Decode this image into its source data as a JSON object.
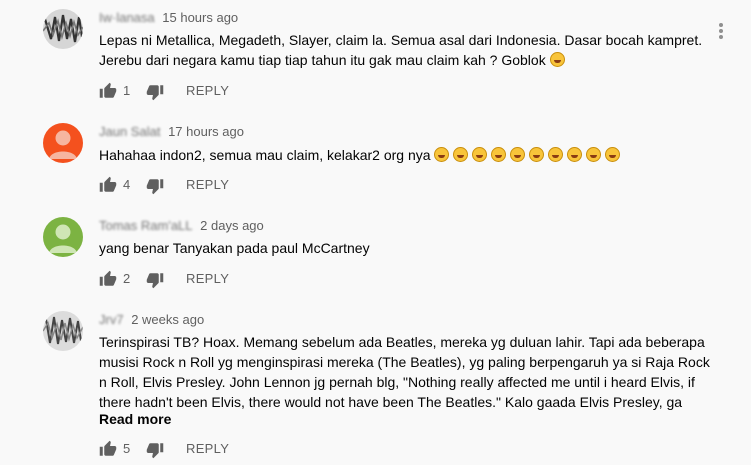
{
  "comments": [
    {
      "author_name": "Iw·lanasa",
      "time": "15 hours ago",
      "text_lines": [
        "Lepas ni Metallica, Megadeth, Slayer, claim la. Semua asal dari Indonesia. Dasar bocah kampret.",
        "Jerebu dari negara kamu tiap tiap tahun itu gak mau claim kah ? Goblok"
      ],
      "likes": "1",
      "reply_label": "REPLY",
      "avatar": "static-pattern-avatar"
    },
    {
      "author_name": "Jaun Salat",
      "time": "17 hours ago",
      "text_lines": [
        "Hahahaa indon2, semua mau claim, kelakar2 org nya"
      ],
      "emoji_count": 10,
      "likes": "4",
      "reply_label": "REPLY",
      "avatar": "default-person-avatar",
      "avatar_color": "#f4511e"
    },
    {
      "author_name": "Tomas Ram'aLL",
      "time": "2 days ago",
      "text_lines": [
        "yang benar Tanyakan pada paul McCartney"
      ],
      "likes": "2",
      "reply_label": "REPLY",
      "avatar": "default-person-avatar",
      "avatar_color": "#7cb342"
    },
    {
      "author_name": "Jrv7",
      "time": "2 weeks ago",
      "text_lines": [
        "Terinspirasi TB? Hoax. Memang sebelum ada Beatles, mereka yg duluan lahir. Tapi ada beberapa",
        "musisi Rock n Roll yg menginspirasi mereka (The Beatles), yg paling berpengaruh ya si Raja Rock",
        "n Roll, Elvis Presley. John Lennon jg pernah blg, \"Nothing really affected me until i heard Elvis, if",
        "there hadn't been Elvis, there would not have been The Beatles.\" Kalo gaada Elvis Presley, ga"
      ],
      "read_more": "Read more",
      "likes": "5",
      "reply_label": "REPLY",
      "avatar": "static-pattern-avatar"
    }
  ]
}
